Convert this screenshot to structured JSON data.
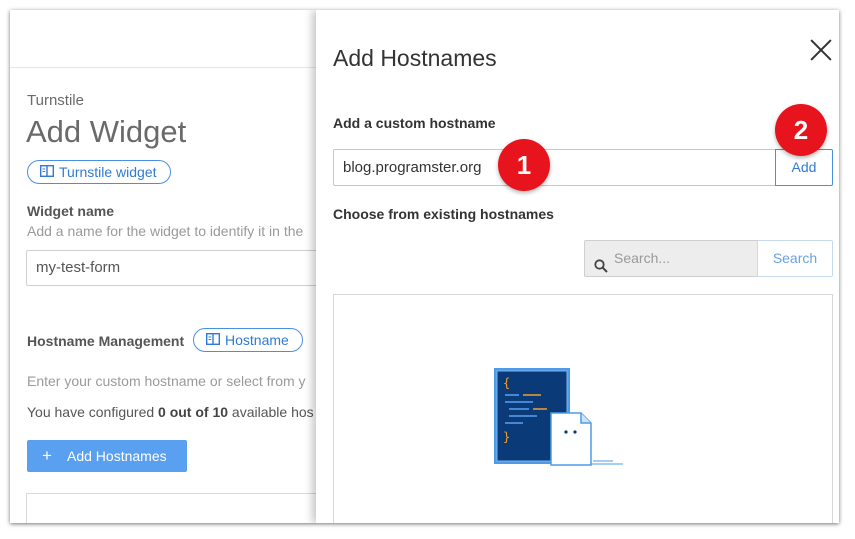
{
  "background_page": {
    "breadcrumb": "Turnstile",
    "title": "Add Widget",
    "docs_link": "Turnstile widget",
    "widget_name_label": "Widget name",
    "widget_name_help": "Add a name for the widget to identify it in the",
    "widget_name_value": "my-test-form",
    "hostname_management_label": "Hostname Management",
    "hostname_link": "Hostname",
    "hostname_help": "Enter your custom hostname or select from y",
    "configured_prefix": "You have configured ",
    "configured_count": "0 out of 10",
    "configured_suffix": " available hos",
    "add_hostnames_button": "Add Hostnames"
  },
  "panel": {
    "title": "Add Hostnames",
    "custom_label": "Add a custom hostname",
    "custom_value": "blog.programster.org",
    "add_button": "Add",
    "existing_label": "Choose from existing hostnames",
    "search_placeholder": "Search...",
    "search_button": "Search"
  },
  "annotations": {
    "step1": "1",
    "step2": "2",
    "badge_color": "#e8141d"
  },
  "icons": [
    "book-icon",
    "plus-icon",
    "close-icon",
    "search-icon",
    "empty-state-illustration"
  ],
  "colors": {
    "accent": "#2f7bd6",
    "button": "#5aa0f0"
  }
}
